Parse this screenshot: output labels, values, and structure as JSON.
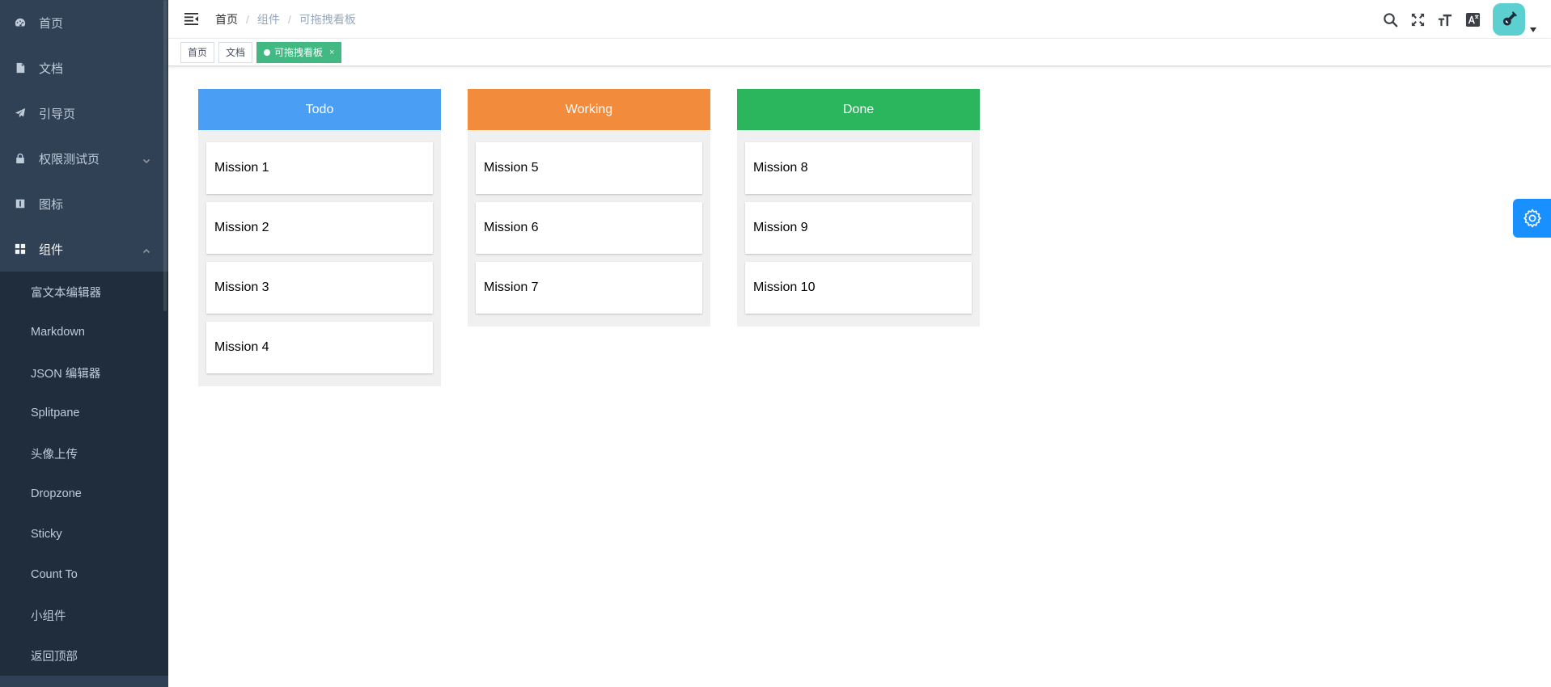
{
  "sidebar": {
    "items": [
      {
        "label": "首页",
        "icon": "dashboard-icon"
      },
      {
        "label": "文档",
        "icon": "document-icon"
      },
      {
        "label": "引导页",
        "icon": "guide-icon"
      },
      {
        "label": "权限测试页",
        "icon": "lock-icon"
      },
      {
        "label": "图标",
        "icon": "icon-icon"
      },
      {
        "label": "组件",
        "icon": "component-icon"
      }
    ],
    "submenu": [
      "富文本编辑器",
      "Markdown",
      "JSON 编辑器",
      "Splitpane",
      "头像上传",
      "Dropzone",
      "Sticky",
      "Count To",
      "小组件",
      "返回顶部"
    ]
  },
  "navbar": {
    "breadcrumb": [
      "首页",
      "组件",
      "可拖拽看板"
    ],
    "icons": [
      "search-icon",
      "fullscreen-icon",
      "font-size-icon",
      "language-icon"
    ]
  },
  "tags": [
    {
      "label": "首页",
      "active": false
    },
    {
      "label": "文档",
      "active": false
    },
    {
      "label": "可拖拽看板",
      "active": true,
      "close": "×"
    }
  ],
  "board": {
    "columns": [
      {
        "title": "Todo",
        "color": "#4a9ff5",
        "cards": [
          "Mission 1",
          "Mission 2",
          "Mission 3",
          "Mission 4"
        ]
      },
      {
        "title": "Working",
        "color": "#f38b3d",
        "cards": [
          "Mission 5",
          "Mission 6",
          "Mission 7"
        ]
      },
      {
        "title": "Done",
        "color": "#2bb65d",
        "cards": [
          "Mission 8",
          "Mission 9",
          "Mission 10"
        ]
      }
    ]
  },
  "colors": {
    "sidebar_bg": "#304156",
    "submenu_bg": "#1f2d3d",
    "tag_active": "#42b983",
    "settings": "#1890ff",
    "avatar": "#5ccfd0"
  }
}
